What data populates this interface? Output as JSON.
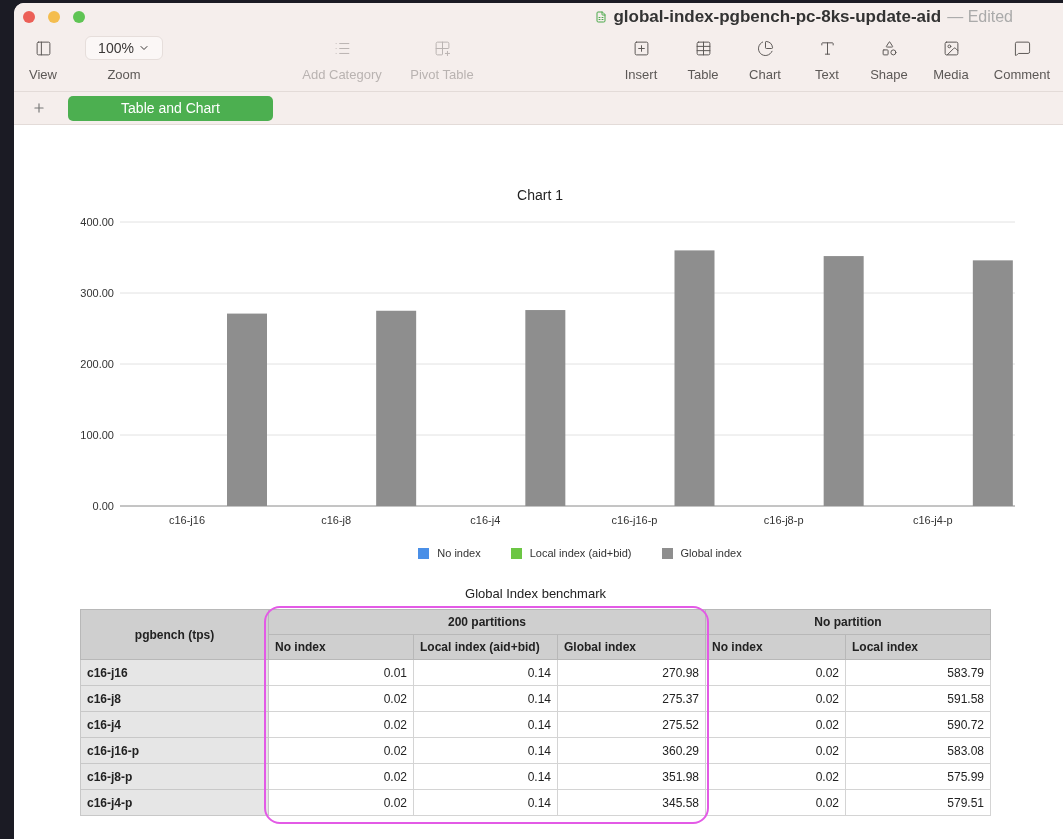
{
  "window": {
    "title": "global-index-pgbench-pc-8ks-update-aid",
    "status": "— Edited"
  },
  "toolbar": [
    {
      "kind": "button",
      "label": "View",
      "disabled": false
    },
    {
      "kind": "dropdown",
      "label": "Zoom",
      "value": "100%",
      "disabled": false
    },
    {
      "kind": "button",
      "label": "Add Category",
      "disabled": true
    },
    {
      "kind": "button",
      "label": "Pivot Table",
      "disabled": true
    },
    {
      "kind": "button",
      "label": "Insert",
      "disabled": false
    },
    {
      "kind": "button",
      "label": "Table",
      "disabled": false
    },
    {
      "kind": "button",
      "label": "Chart",
      "disabled": false
    },
    {
      "kind": "button",
      "label": "Text",
      "disabled": false
    },
    {
      "kind": "button",
      "label": "Shape",
      "disabled": false
    },
    {
      "kind": "button",
      "label": "Media",
      "disabled": false
    },
    {
      "kind": "button",
      "label": "Comment",
      "disabled": false
    }
  ],
  "sheet_tabs": [
    {
      "label": "Table and Chart",
      "selected": true
    }
  ],
  "chart": {
    "chart_data": {
      "type": "bar",
      "title": "Chart 1",
      "categories": [
        "c16-j16",
        "c16-j8",
        "c16-j4",
        "c16-j16-p",
        "c16-j8-p",
        "c16-j4-p"
      ],
      "series": [
        {
          "name": "No index",
          "color": "#4a8fe7",
          "values": [
            0,
            0,
            0,
            0,
            0,
            0
          ]
        },
        {
          "name": "Local index (aid+bid)",
          "color": "#6cc644",
          "values": [
            0,
            0,
            0,
            0,
            0,
            0
          ]
        },
        {
          "name": "Global index",
          "color": "#8e8e8e",
          "values": [
            271,
            275,
            276,
            360,
            352,
            346
          ]
        }
      ],
      "grid": true,
      "legend": "bottom",
      "ylim": [
        0,
        400
      ],
      "yticks": [
        {
          "value": 0,
          "label": "0.00"
        },
        {
          "value": 100,
          "label": "100.00"
        },
        {
          "value": 200,
          "label": "200.00"
        },
        {
          "value": 300,
          "label": "300.00"
        },
        {
          "value": 400,
          "label": "400.00"
        }
      ]
    }
  },
  "table": {
    "title": "Global Index benchmark",
    "corner": "pgbench (tps)",
    "column_groups": [
      {
        "label": "200 partitions",
        "highlighted": true,
        "columns": [
          "No index",
          "Local index (aid+bid)",
          "Global index"
        ]
      },
      {
        "label": "No partition",
        "highlighted": false,
        "columns": [
          "No index",
          "Local index"
        ]
      }
    ],
    "rows": [
      {
        "label": "c16-j16",
        "cells": [
          "0.01",
          "0.14",
          "270.98",
          "0.02",
          "583.79"
        ]
      },
      {
        "label": "c16-j8",
        "cells": [
          "0.02",
          "0.14",
          "275.37",
          "0.02",
          "591.58"
        ]
      },
      {
        "label": "c16-j4",
        "cells": [
          "0.02",
          "0.14",
          "275.52",
          "0.02",
          "590.72"
        ]
      },
      {
        "label": "c16-j16-p",
        "cells": [
          "0.02",
          "0.14",
          "360.29",
          "0.02",
          "583.08"
        ]
      },
      {
        "label": "c16-j8-p",
        "cells": [
          "0.02",
          "0.14",
          "351.98",
          "0.02",
          "575.99"
        ]
      },
      {
        "label": "c16-j4-p",
        "cells": [
          "0.02",
          "0.14",
          "345.58",
          "0.02",
          "579.51"
        ]
      }
    ]
  }
}
